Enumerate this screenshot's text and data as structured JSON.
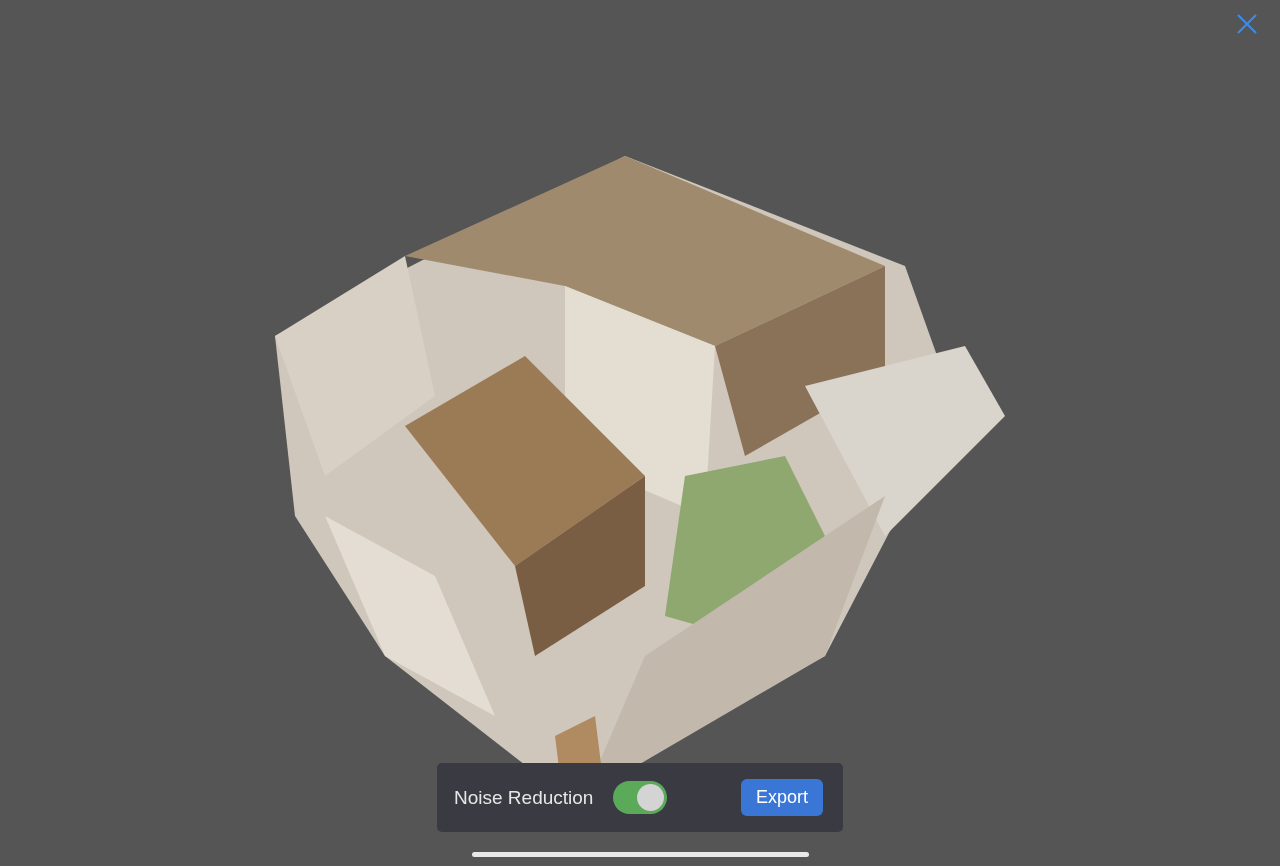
{
  "toolbar": {
    "noise_reduction": {
      "label": "Noise Reduction",
      "on": true
    },
    "export_button": {
      "label": "Export"
    }
  }
}
